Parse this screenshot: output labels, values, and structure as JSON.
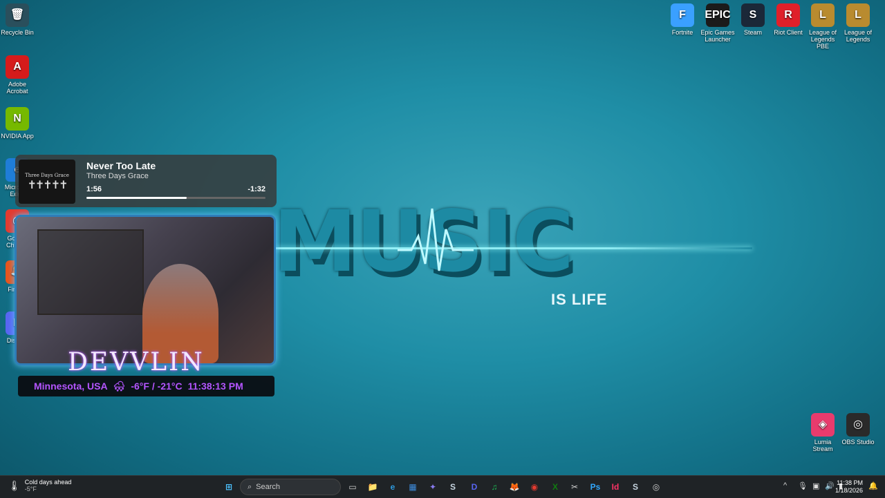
{
  "desktop_icons_left": [
    {
      "name": "recycle-bin",
      "label": "Recycle Bin",
      "glyph": "🗑",
      "color": "#2a4f5c"
    },
    {
      "name": "adobe-acrobat",
      "label": "Adobe Acrobat",
      "glyph": "A",
      "color": "#d61b1b"
    },
    {
      "name": "nvidia-app",
      "label": "NVIDIA App",
      "glyph": "N",
      "color": "#76b900"
    },
    {
      "name": "microsoft-edge",
      "label": "Microsoft Edge",
      "glyph": "e",
      "color": "#1f7dd8"
    },
    {
      "name": "google-chrome",
      "label": "Google Chrome",
      "glyph": "◉",
      "color": "#e43a2f"
    },
    {
      "name": "firefox",
      "label": "Firefox",
      "glyph": "🦊",
      "color": "#e7541c"
    },
    {
      "name": "discord",
      "label": "Discord",
      "glyph": "D",
      "color": "#5865f2"
    }
  ],
  "desktop_icons_right": [
    {
      "name": "fortnite",
      "label": "Fortnite",
      "glyph": "F",
      "color": "#3aa0ff"
    },
    {
      "name": "epic-games-launcher",
      "label": "Epic Games Launcher",
      "glyph": "EPIC",
      "color": "#1b1b1b"
    },
    {
      "name": "steam",
      "label": "Steam",
      "glyph": "S",
      "color": "#1b2838"
    },
    {
      "name": "riot-client",
      "label": "Riot Client",
      "glyph": "R",
      "color": "#e0202a"
    },
    {
      "name": "league-of-legends-pbe",
      "label": "League of Legends PBE",
      "glyph": "L",
      "color": "#b98b2f"
    },
    {
      "name": "league-of-legends",
      "label": "League of Legends",
      "glyph": "L",
      "color": "#b98b2f"
    }
  ],
  "desktop_icons_bottom_right": [
    {
      "name": "lumia-stream",
      "label": "Lumia Stream",
      "glyph": "◈",
      "color": "#e83b6d"
    },
    {
      "name": "obs-studio",
      "label": "OBS Studio",
      "glyph": "◎",
      "color": "#2a2a2a"
    }
  ],
  "wallpaper": {
    "main": "MUSIC",
    "sub": "IS LIFE"
  },
  "media": {
    "title": "Never Too Late",
    "artist": "Three Days Grace",
    "album_art_text": "Three Days Grace",
    "elapsed": "1:56",
    "remaining": "-1:32",
    "progress": 0.56
  },
  "overlay": {
    "streamer": "DEVVLIN",
    "location": "Minnesota, USA",
    "weather_icon": "🌨",
    "temperature": "-6°F / -21°C",
    "time": "11:38:13 PM"
  },
  "taskbar": {
    "weather_title": "Cold days ahead",
    "weather_temp": "-5°F",
    "search_placeholder": "Search",
    "clock_time": "11:38 PM",
    "clock_date": "1/18/2026",
    "apps": [
      {
        "name": "start-icon",
        "glyph": "⊞",
        "color": "#4cc2ff"
      },
      {
        "name": "task-view-icon",
        "glyph": "▭",
        "color": "#cfcfcf"
      },
      {
        "name": "file-explorer-icon",
        "glyph": "📁",
        "color": "#f2c14e"
      },
      {
        "name": "edge-icon",
        "glyph": "e",
        "color": "#2e9be0"
      },
      {
        "name": "store-icon",
        "glyph": "▦",
        "color": "#3d8bdb"
      },
      {
        "name": "copilot-icon",
        "glyph": "✦",
        "color": "#8a7cf0"
      },
      {
        "name": "steam-icon",
        "glyph": "S",
        "color": "#c7d5e0"
      },
      {
        "name": "discord-icon",
        "glyph": "D",
        "color": "#5865f2"
      },
      {
        "name": "spotify-icon",
        "glyph": "♫",
        "color": "#1db954"
      },
      {
        "name": "firefox-icon",
        "glyph": "🦊",
        "color": "#e7541c"
      },
      {
        "name": "chrome-icon",
        "glyph": "◉",
        "color": "#e43a2f"
      },
      {
        "name": "xbox-icon",
        "glyph": "X",
        "color": "#107c10"
      },
      {
        "name": "snipping-icon",
        "glyph": "✂",
        "color": "#cfcfcf"
      },
      {
        "name": "photoshop-icon",
        "glyph": "Ps",
        "color": "#31a8ff"
      },
      {
        "name": "indesign-icon",
        "glyph": "Id",
        "color": "#ff3366"
      },
      {
        "name": "steam2-icon",
        "glyph": "S",
        "color": "#c7d5e0"
      },
      {
        "name": "obs-icon",
        "glyph": "◎",
        "color": "#cfcfcf"
      }
    ],
    "tray": [
      {
        "name": "tray-chevron-icon",
        "glyph": "^"
      },
      {
        "name": "mic-icon",
        "glyph": "🎙"
      },
      {
        "name": "network-icon",
        "glyph": "▣"
      },
      {
        "name": "volume-icon",
        "glyph": "🔊"
      },
      {
        "name": "battery-icon",
        "glyph": "▮"
      }
    ]
  }
}
